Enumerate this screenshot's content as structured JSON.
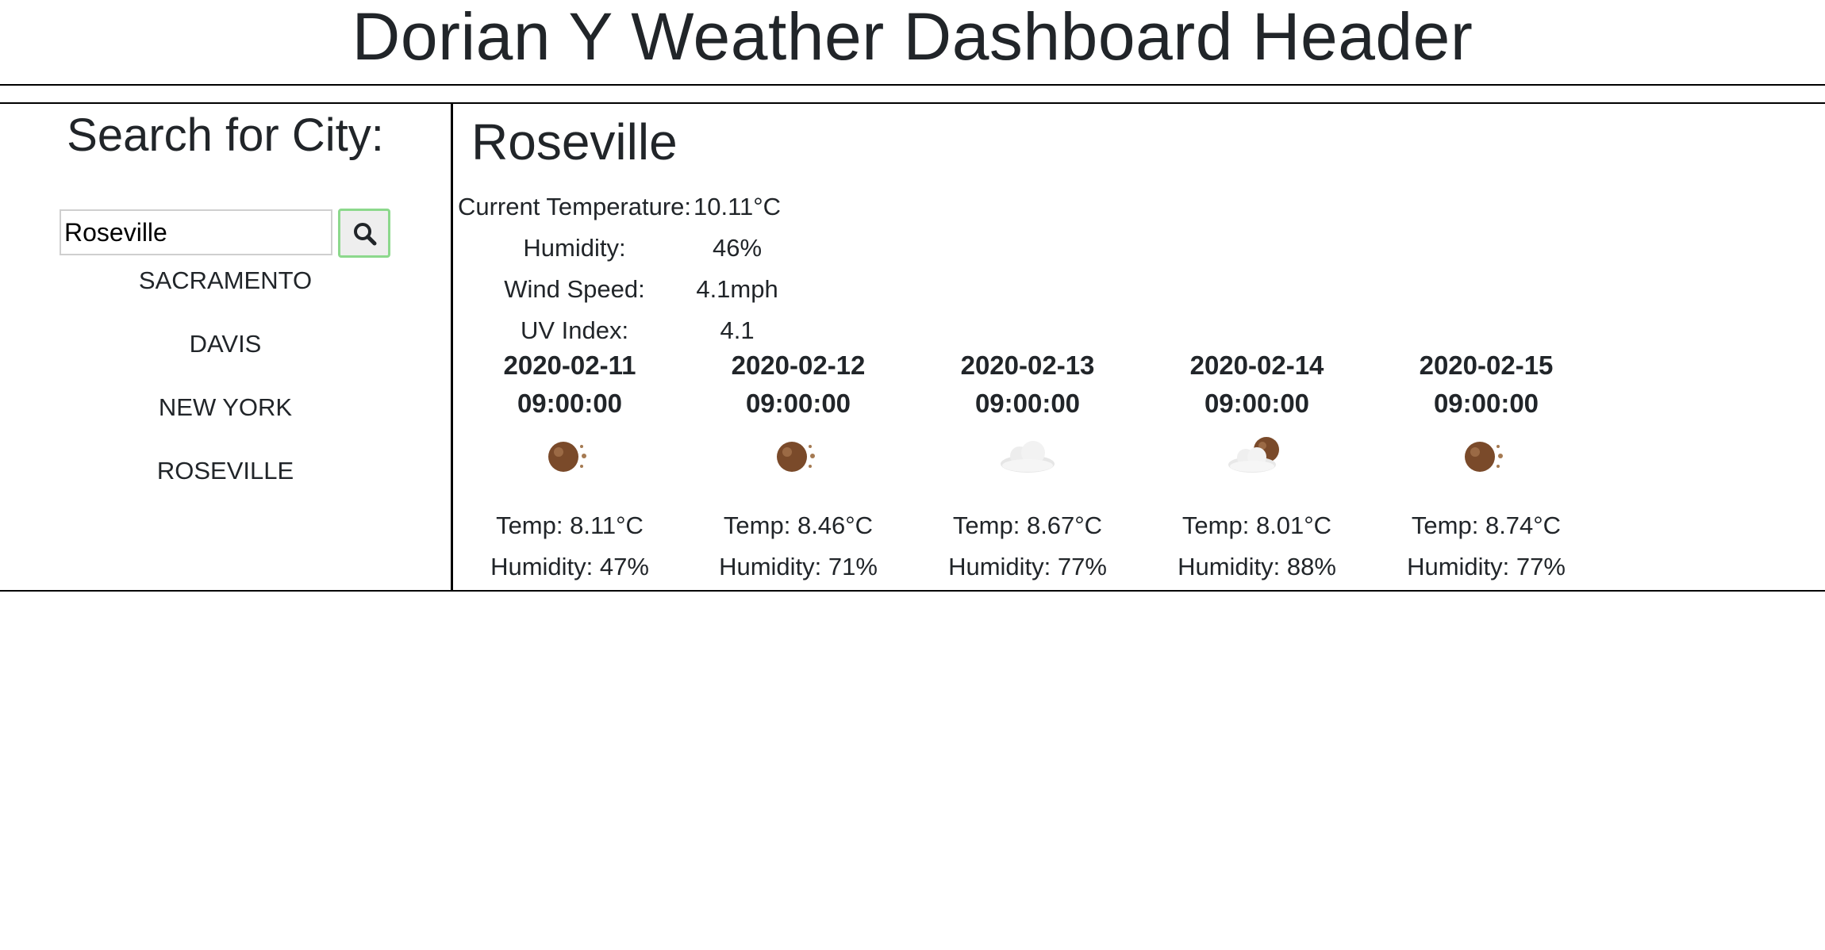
{
  "header": {
    "title": "Dorian Y Weather Dashboard Header"
  },
  "sidebar": {
    "heading": "Search for City:",
    "search": {
      "value": "Roseville",
      "placeholder": "",
      "button_icon": "search-icon"
    },
    "cities": [
      "SACRAMENTO",
      "DAVIS",
      "NEW YORK",
      "ROSEVILLE"
    ]
  },
  "current": {
    "city": "Roseville",
    "temperature_label": "Current Temperature:",
    "temperature_value": "10.11°C",
    "humidity_label": "Humidity:",
    "humidity_value": "46%",
    "wind_label": "Wind Speed:",
    "wind_value": "4.1mph",
    "uv_label": "UV Index:",
    "uv_value": "4.1"
  },
  "forecast": [
    {
      "date": "2020-02-11",
      "time": "09:00:00",
      "icon": "clear-night-icon",
      "temp": "Temp: 8.11°C",
      "humidity": "Humidity: 47%"
    },
    {
      "date": "2020-02-12",
      "time": "09:00:00",
      "icon": "clear-night-icon",
      "temp": "Temp: 8.46°C",
      "humidity": "Humidity: 71%"
    },
    {
      "date": "2020-02-13",
      "time": "09:00:00",
      "icon": "cloud-icon",
      "temp": "Temp: 8.67°C",
      "humidity": "Humidity: 77%"
    },
    {
      "date": "2020-02-14",
      "time": "09:00:00",
      "icon": "partly-cloudy-night-icon",
      "temp": "Temp: 8.01°C",
      "humidity": "Humidity: 88%"
    },
    {
      "date": "2020-02-15",
      "time": "09:00:00",
      "icon": "clear-night-icon",
      "temp": "Temp: 8.74°C",
      "humidity": "Humidity: 77%"
    }
  ],
  "colors": {
    "text": "#212529",
    "border": "#000000",
    "button_focus": "#8cd88c",
    "moon": "#7a4a2a"
  }
}
